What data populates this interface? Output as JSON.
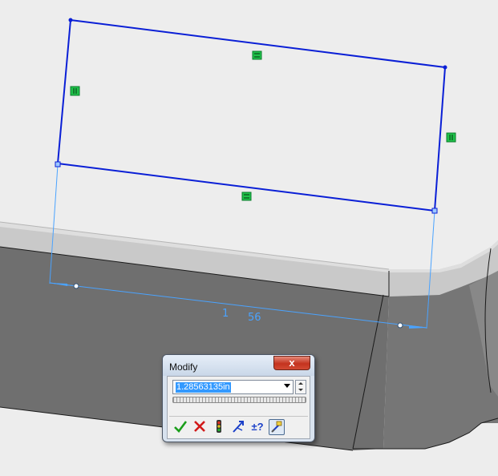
{
  "viewport": {
    "dimension_text": [
      "1",
      "56"
    ]
  },
  "modify_dialog": {
    "title": "Modify",
    "close_label": "x",
    "value": "1.28563135in",
    "toolbar": {
      "ok_icon": "check-icon",
      "cancel_icon": "close-x-icon",
      "rebuild_icon": "traffic-light-icon",
      "reverse_icon": "reverse-dimension-icon",
      "increment_label": "±?",
      "mark_icon": "mark-dimension-icon"
    }
  },
  "colors": {
    "sketch_line": "#0a1fd6",
    "construction": "#4aa3ff",
    "constraint_badge": "#1fc24a",
    "model_face": "#6e6e6e"
  }
}
